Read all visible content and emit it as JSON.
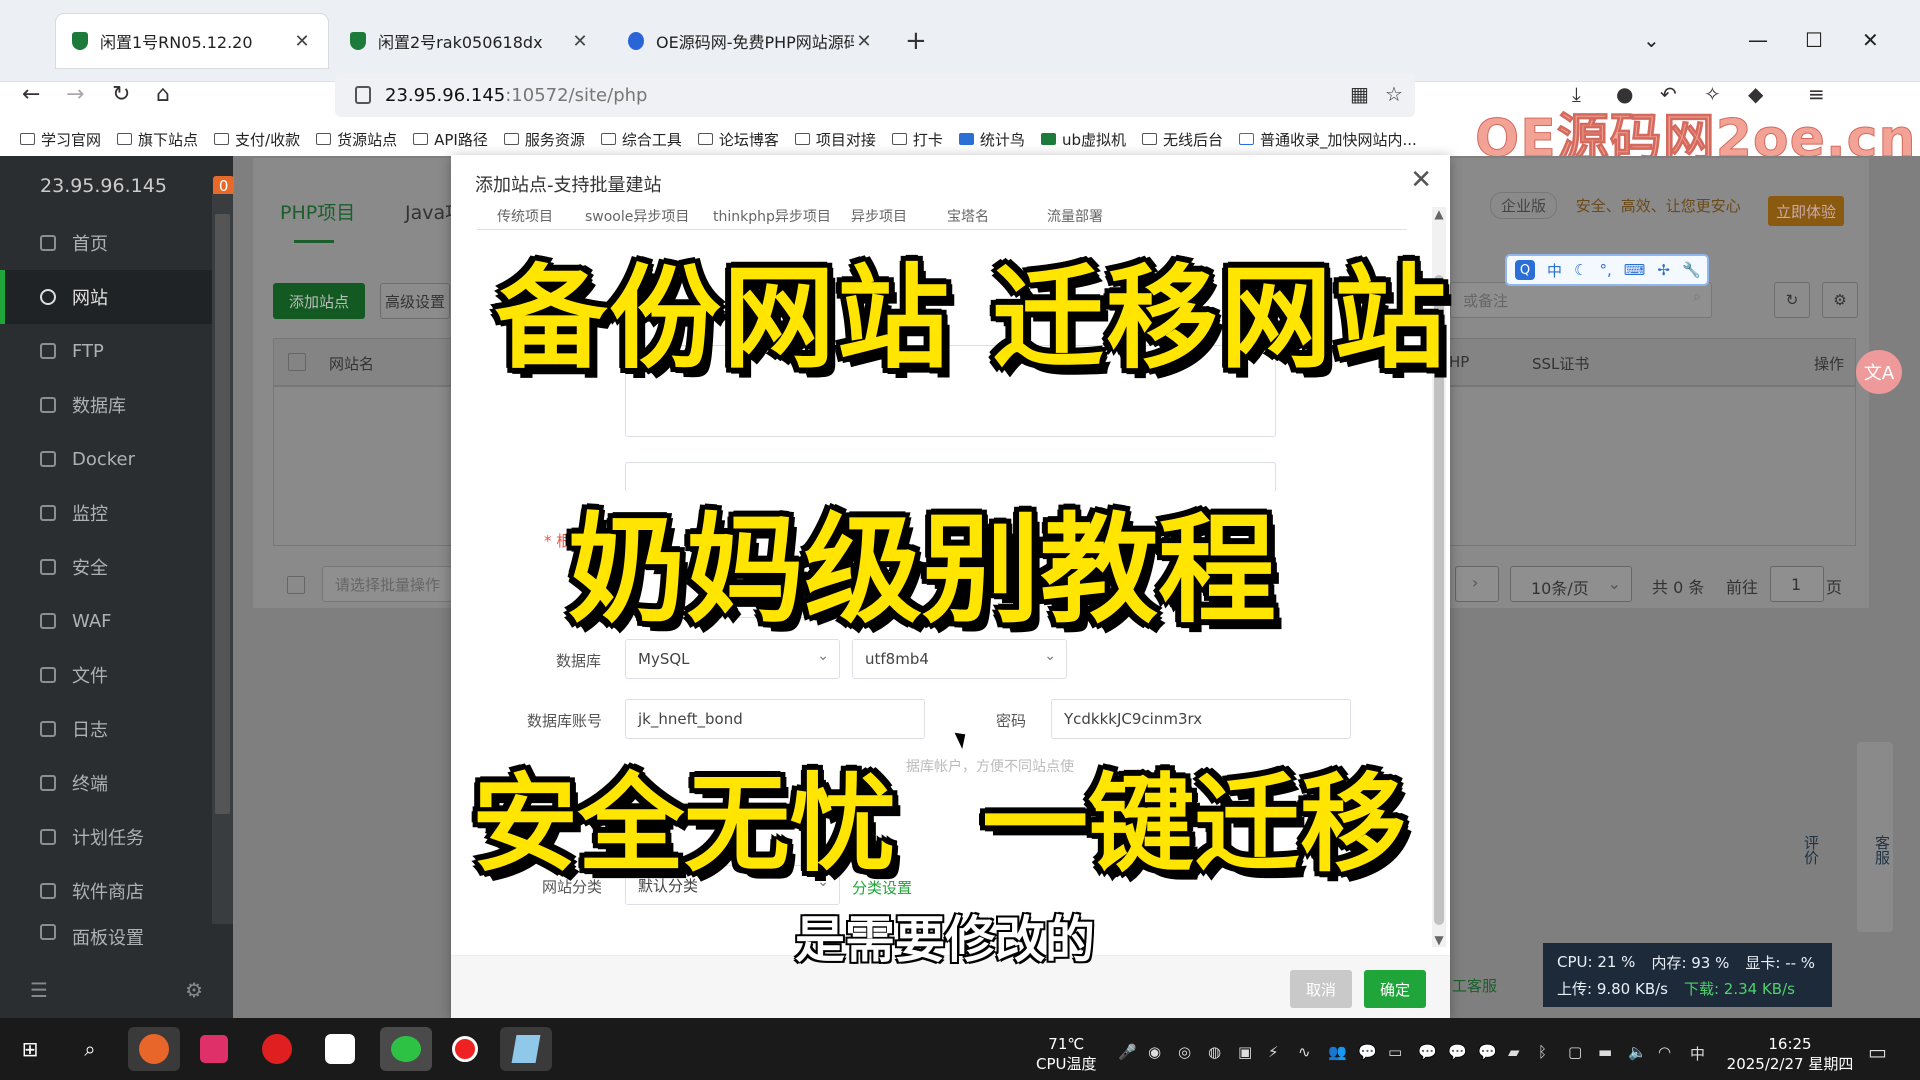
{
  "browser": {
    "tabs": [
      {
        "label": "闲置1号RN05.12.20",
        "active": true
      },
      {
        "label": "闲置2号rak050618dx",
        "active": false
      },
      {
        "label": "OE源码网-免费PHP网站源码模",
        "active": false
      }
    ],
    "new_tab": "+",
    "url_host": "23.95.96.145",
    "url_path": ":10572/site/php",
    "bookmarks": [
      "学习官网",
      "旗下站点",
      "支付/收款",
      "货源站点",
      "API路径",
      "服务资源",
      "综合工具",
      "论坛博客",
      "项目对接",
      "打卡",
      "统计鸟",
      "ub虚拟机",
      "无线后台",
      "普通收录_加快网站内..."
    ]
  },
  "watermark": "OE源码网2oe.cn",
  "panel": {
    "server_ip": "23.95.96.145",
    "alert_count": "0",
    "nav": [
      {
        "label": "首页",
        "icon": "home-icon"
      },
      {
        "label": "网站",
        "icon": "globe-icon",
        "active": true
      },
      {
        "label": "FTP",
        "icon": "ftp-icon"
      },
      {
        "label": "数据库",
        "icon": "database-icon"
      },
      {
        "label": "Docker",
        "icon": "docker-icon"
      },
      {
        "label": "监控",
        "icon": "monitor-icon"
      },
      {
        "label": "安全",
        "icon": "security-icon"
      },
      {
        "label": "WAF",
        "icon": "waf-icon"
      },
      {
        "label": "文件",
        "icon": "folder-icon"
      },
      {
        "label": "日志",
        "icon": "log-icon"
      },
      {
        "label": "终端",
        "icon": "terminal-icon"
      },
      {
        "label": "计划任务",
        "icon": "schedule-icon"
      },
      {
        "label": "软件商店",
        "icon": "store-icon"
      },
      {
        "label": "面板设置",
        "icon": "settings-icon"
      }
    ],
    "tabs": {
      "php": "PHP项目",
      "java": "Java项"
    },
    "add_site_button": "添加站点",
    "advanced_settings_button": "高级设置",
    "search_placeholder": "或备注",
    "table_headers": {
      "site_name": "网站名",
      "php": "HP",
      "ssl": "SSL证书",
      "actions": "操作"
    },
    "batch_placeholder": "请选择批量操作",
    "promo": {
      "edition": "企业版",
      "slogan": "安全、高效、让您更安心",
      "button": "立即体验"
    },
    "pager": {
      "per_page": "10条/页",
      "total": "共 0 条",
      "goto": "前往",
      "page": "1",
      "page_suffix": "页"
    },
    "customer_service": "工客服",
    "float": {
      "service": "客服",
      "review": "评价"
    },
    "translate_badge": "文A"
  },
  "modal": {
    "title": "添加站点-支持批量建站",
    "tabs": [
      "传统项目",
      "swoole异步项目",
      "thinkphp异步项目",
      "异步项目",
      "宝塔名",
      "流量部署"
    ],
    "root_label": "* 根",
    "database_label": "数据库",
    "database_type": "MySQL",
    "charset": "utf8mb4",
    "db_account_label": "数据库账号",
    "db_account_value": "jk_hneft_bond",
    "password_label": "密码",
    "password_value": "YcdkkkJC9cinm3rx",
    "hint": "据库帐户，方便不同站点使",
    "category_label": "网站分类",
    "category_value": "默认分类",
    "category_link": "分类设置",
    "cancel": "取消",
    "confirm": "确定"
  },
  "overlay": {
    "line1": "备份网站 迁移网站",
    "line2": "奶妈级别教程",
    "line3a": "安全无忧",
    "line3b": "一键迁移",
    "subtitle": "是需要修改的"
  },
  "ime": {
    "q": "Q",
    "mode": "中"
  },
  "stats": {
    "cpu": "CPU: 21 %",
    "mem": "内存: 93 %",
    "gpu": "显卡: -- %",
    "up": "上传: 9.80 KB/s",
    "down": "下载: 2.34 KB/s"
  },
  "taskbar": {
    "temp": "71℃",
    "temp_label": "CPU温度",
    "ime_lang": "中",
    "time": "16:25",
    "date": "2025/2/27 星期四"
  }
}
